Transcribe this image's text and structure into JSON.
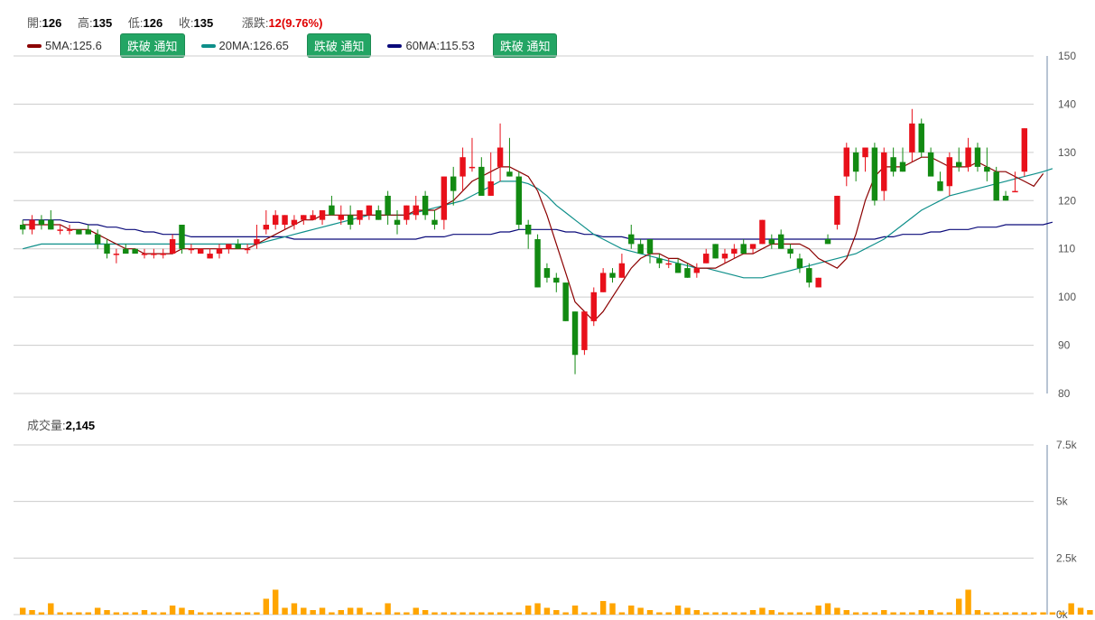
{
  "header": {
    "open_label": "開:",
    "open": "126",
    "high_label": "高:",
    "high": "135",
    "low_label": "低:",
    "low": "126",
    "close_label": "收:",
    "close": "135",
    "change_label": "漲跌:",
    "change": "12(9.76%)"
  },
  "ma_legend": [
    {
      "label": "5MA:125.6",
      "color": "#8b0000",
      "button": "跌破 通知"
    },
    {
      "label": "20MA:126.65",
      "color": "#0e8f8a",
      "button": "跌破 通知"
    },
    {
      "label": "60MA:115.53",
      "color": "#0a0a7a",
      "button": "跌破 通知"
    }
  ],
  "volume_header": {
    "label": "成交量:",
    "value": "2,145"
  },
  "colors": {
    "up": "#e8101a",
    "down": "#128a12",
    "volume": "#ffa500",
    "grid": "#cccccc"
  },
  "chart_data": [
    {
      "type": "candlestick",
      "title": "",
      "ylim": [
        80,
        150
      ],
      "yticks": [
        "150",
        "140",
        "130",
        "120",
        "110",
        "100",
        "90",
        "80"
      ],
      "candles": [
        {
          "o": 115,
          "h": 116,
          "l": 113,
          "c": 114
        },
        {
          "o": 114,
          "h": 117,
          "l": 113,
          "c": 116
        },
        {
          "o": 116,
          "h": 117,
          "l": 114,
          "c": 115
        },
        {
          "o": 116,
          "h": 118,
          "l": 114,
          "c": 114
        },
        {
          "o": 114,
          "h": 115,
          "l": 113,
          "c": 114
        },
        {
          "o": 114,
          "h": 115,
          "l": 113,
          "c": 114
        },
        {
          "o": 114,
          "h": 114,
          "l": 113,
          "c": 113
        },
        {
          "o": 114,
          "h": 115,
          "l": 113,
          "c": 113
        },
        {
          "o": 113,
          "h": 114,
          "l": 110,
          "c": 111
        },
        {
          "o": 111,
          "h": 112,
          "l": 108,
          "c": 109
        },
        {
          "o": 109,
          "h": 110,
          "l": 107,
          "c": 109
        },
        {
          "o": 110,
          "h": 111,
          "l": 109,
          "c": 109
        },
        {
          "o": 110,
          "h": 110,
          "l": 109,
          "c": 109
        },
        {
          "o": 109,
          "h": 110,
          "l": 108,
          "c": 109
        },
        {
          "o": 109,
          "h": 110,
          "l": 108,
          "c": 109
        },
        {
          "o": 109,
          "h": 110,
          "l": 108,
          "c": 109
        },
        {
          "o": 109,
          "h": 113,
          "l": 109,
          "c": 112
        },
        {
          "o": 115,
          "h": 115,
          "l": 109,
          "c": 110
        },
        {
          "o": 110,
          "h": 111,
          "l": 109,
          "c": 110
        },
        {
          "o": 109,
          "h": 110,
          "l": 109,
          "c": 110
        },
        {
          "o": 108,
          "h": 110,
          "l": 108,
          "c": 109
        },
        {
          "o": 109,
          "h": 111,
          "l": 108,
          "c": 110
        },
        {
          "o": 110,
          "h": 111,
          "l": 109,
          "c": 111
        },
        {
          "o": 111,
          "h": 112,
          "l": 110,
          "c": 110
        },
        {
          "o": 110,
          "h": 111,
          "l": 109,
          "c": 110
        },
        {
          "o": 111,
          "h": 115,
          "l": 110,
          "c": 112
        },
        {
          "o": 114,
          "h": 118,
          "l": 113,
          "c": 115
        },
        {
          "o": 115,
          "h": 118,
          "l": 114,
          "c": 117
        },
        {
          "o": 115,
          "h": 117,
          "l": 114,
          "c": 117
        },
        {
          "o": 115,
          "h": 117,
          "l": 114,
          "c": 116
        },
        {
          "o": 116,
          "h": 117,
          "l": 115,
          "c": 117
        },
        {
          "o": 116,
          "h": 118,
          "l": 116,
          "c": 117
        },
        {
          "o": 116,
          "h": 118,
          "l": 115,
          "c": 118
        },
        {
          "o": 119,
          "h": 121,
          "l": 117,
          "c": 117
        },
        {
          "o": 116,
          "h": 119,
          "l": 115,
          "c": 117
        },
        {
          "o": 117,
          "h": 119,
          "l": 114,
          "c": 115
        },
        {
          "o": 116,
          "h": 118,
          "l": 115,
          "c": 118
        },
        {
          "o": 117,
          "h": 119,
          "l": 116,
          "c": 119
        },
        {
          "o": 118,
          "h": 119,
          "l": 116,
          "c": 116
        },
        {
          "o": 121,
          "h": 122,
          "l": 115,
          "c": 117
        },
        {
          "o": 116,
          "h": 118,
          "l": 113,
          "c": 115
        },
        {
          "o": 116,
          "h": 119,
          "l": 115,
          "c": 119
        },
        {
          "o": 117,
          "h": 121,
          "l": 116,
          "c": 119
        },
        {
          "o": 121,
          "h": 122,
          "l": 116,
          "c": 117
        },
        {
          "o": 116,
          "h": 118,
          "l": 114,
          "c": 115
        },
        {
          "o": 116,
          "h": 125,
          "l": 114,
          "c": 125
        },
        {
          "o": 125,
          "h": 127,
          "l": 119,
          "c": 122
        },
        {
          "o": 125,
          "h": 131,
          "l": 122,
          "c": 129
        },
        {
          "o": 127,
          "h": 133,
          "l": 126,
          "c": 127
        },
        {
          "o": 127,
          "h": 129,
          "l": 124,
          "c": 121
        },
        {
          "o": 121,
          "h": 130,
          "l": 121,
          "c": 124
        },
        {
          "o": 127,
          "h": 136,
          "l": 124,
          "c": 131
        },
        {
          "o": 126,
          "h": 133,
          "l": 125,
          "c": 125
        },
        {
          "o": 125,
          "h": 126,
          "l": 114,
          "c": 115
        },
        {
          "o": 115,
          "h": 116,
          "l": 110,
          "c": 113
        },
        {
          "o": 112,
          "h": 113,
          "l": 102,
          "c": 102
        },
        {
          "o": 106,
          "h": 107,
          "l": 103,
          "c": 104
        },
        {
          "o": 104,
          "h": 105,
          "l": 101,
          "c": 103
        },
        {
          "o": 103,
          "h": 103,
          "l": 95,
          "c": 95
        },
        {
          "o": 97,
          "h": 97,
          "l": 84,
          "c": 88
        },
        {
          "o": 89,
          "h": 97,
          "l": 88,
          "c": 97
        },
        {
          "o": 95,
          "h": 102,
          "l": 94,
          "c": 101
        },
        {
          "o": 101,
          "h": 106,
          "l": 101,
          "c": 105
        },
        {
          "o": 105,
          "h": 106,
          "l": 103,
          "c": 104
        },
        {
          "o": 104,
          "h": 109,
          "l": 104,
          "c": 107
        },
        {
          "o": 113,
          "h": 115,
          "l": 110,
          "c": 111
        },
        {
          "o": 111,
          "h": 112,
          "l": 109,
          "c": 109
        },
        {
          "o": 112,
          "h": 112,
          "l": 107,
          "c": 109
        },
        {
          "o": 108,
          "h": 109,
          "l": 106,
          "c": 107
        },
        {
          "o": 107,
          "h": 108,
          "l": 106,
          "c": 107
        },
        {
          "o": 107,
          "h": 108,
          "l": 105,
          "c": 105
        },
        {
          "o": 106,
          "h": 107,
          "l": 104,
          "c": 104
        },
        {
          "o": 105,
          "h": 107,
          "l": 104,
          "c": 106
        },
        {
          "o": 107,
          "h": 110,
          "l": 107,
          "c": 109
        },
        {
          "o": 111,
          "h": 111,
          "l": 108,
          "c": 108
        },
        {
          "o": 108,
          "h": 110,
          "l": 107,
          "c": 109
        },
        {
          "o": 109,
          "h": 111,
          "l": 108,
          "c": 110
        },
        {
          "o": 111,
          "h": 112,
          "l": 109,
          "c": 109
        },
        {
          "o": 110,
          "h": 111,
          "l": 109,
          "c": 111
        },
        {
          "o": 111,
          "h": 116,
          "l": 111,
          "c": 116
        },
        {
          "o": 112,
          "h": 113,
          "l": 110,
          "c": 111
        },
        {
          "o": 113,
          "h": 114,
          "l": 110,
          "c": 110
        },
        {
          "o": 110,
          "h": 111,
          "l": 108,
          "c": 109
        },
        {
          "o": 108,
          "h": 109,
          "l": 105,
          "c": 106
        },
        {
          "o": 106,
          "h": 107,
          "l": 102,
          "c": 103
        },
        {
          "o": 102,
          "h": 104,
          "l": 102,
          "c": 104
        },
        {
          "o": 112,
          "h": 113,
          "l": 111,
          "c": 111
        },
        {
          "o": 115,
          "h": 121,
          "l": 114,
          "c": 121
        },
        {
          "o": 125,
          "h": 132,
          "l": 123,
          "c": 131
        },
        {
          "o": 130,
          "h": 131,
          "l": 124,
          "c": 126
        },
        {
          "o": 129,
          "h": 131,
          "l": 126,
          "c": 131
        },
        {
          "o": 131,
          "h": 132,
          "l": 119,
          "c": 120
        },
        {
          "o": 122,
          "h": 131,
          "l": 120,
          "c": 130
        },
        {
          "o": 129,
          "h": 131,
          "l": 125,
          "c": 126
        },
        {
          "o": 128,
          "h": 131,
          "l": 126,
          "c": 126
        },
        {
          "o": 130,
          "h": 139,
          "l": 128,
          "c": 136
        },
        {
          "o": 136,
          "h": 137,
          "l": 129,
          "c": 130
        },
        {
          "o": 130,
          "h": 131,
          "l": 126,
          "c": 125
        },
        {
          "o": 124,
          "h": 126,
          "l": 122,
          "c": 122
        },
        {
          "o": 123,
          "h": 130,
          "l": 121,
          "c": 129
        },
        {
          "o": 128,
          "h": 131,
          "l": 126,
          "c": 127
        },
        {
          "o": 127,
          "h": 133,
          "l": 126,
          "c": 131
        },
        {
          "o": 131,
          "h": 132,
          "l": 126,
          "c": 127
        },
        {
          "o": 127,
          "h": 131,
          "l": 124,
          "c": 126
        },
        {
          "o": 126,
          "h": 127,
          "l": 120,
          "c": 120
        },
        {
          "o": 121,
          "h": 122,
          "l": 120,
          "c": 120
        },
        {
          "o": 122,
          "h": 126,
          "l": 122,
          "c": 122
        },
        {
          "o": 126,
          "h": 135,
          "l": 125,
          "c": 135
        }
      ],
      "ma5": [
        115,
        115,
        115,
        115,
        115,
        114,
        114,
        114,
        113,
        112,
        111,
        110,
        110,
        109,
        109,
        109,
        109,
        110,
        110,
        110,
        110,
        110,
        110,
        110,
        110,
        111,
        112,
        113,
        114,
        115,
        116,
        116,
        117,
        117,
        117,
        117,
        117,
        117,
        117,
        117,
        117,
        117,
        118,
        118,
        118,
        119,
        120,
        122,
        124,
        125,
        126,
        127,
        127,
        126,
        125,
        122,
        117,
        111,
        105,
        99,
        97,
        95,
        97,
        100,
        103,
        106,
        108,
        109,
        109,
        108,
        108,
        107,
        106,
        106,
        106,
        107,
        108,
        109,
        109,
        110,
        111,
        111,
        111,
        111,
        110,
        108,
        107,
        106,
        108,
        113,
        120,
        125,
        127,
        127,
        127,
        128,
        129,
        129,
        128,
        127,
        127,
        127,
        128,
        127,
        126,
        126,
        125,
        124,
        123,
        125.6
      ],
      "ma20": [
        110,
        110.5,
        111,
        111,
        111,
        111,
        111,
        111,
        111,
        111,
        111,
        111,
        111,
        111,
        111,
        111,
        111,
        111,
        111,
        111,
        111,
        111,
        111,
        111,
        111,
        111,
        111.5,
        112,
        112.5,
        113,
        113.5,
        114,
        114.5,
        115,
        115.5,
        116,
        116.5,
        117,
        117,
        117,
        117,
        117,
        117.5,
        118,
        118.5,
        119,
        119.5,
        120,
        121,
        122,
        123,
        124,
        124,
        124,
        123.5,
        122.5,
        121,
        119,
        117.5,
        116,
        114.5,
        113,
        112,
        111,
        110,
        109.5,
        109,
        108.5,
        108,
        107.5,
        107,
        106.5,
        106,
        106,
        105.5,
        105,
        104.5,
        104,
        104,
        104,
        104.5,
        105,
        105.5,
        106,
        106.5,
        107,
        107.5,
        108,
        108.5,
        109,
        110,
        111,
        112,
        113.5,
        115,
        116.5,
        118,
        119,
        120,
        121,
        121.5,
        122,
        122.5,
        123,
        123.5,
        124,
        124.5,
        125,
        125.5,
        126,
        126.65
      ],
      "ma60": [
        116,
        116,
        116,
        116,
        116,
        115.5,
        115.5,
        115,
        115,
        114.5,
        114.5,
        114,
        114,
        113.5,
        113.5,
        113,
        113,
        113,
        112.5,
        112.5,
        112.5,
        112.5,
        112.5,
        112.5,
        112.5,
        112.5,
        112.5,
        112.5,
        112.5,
        112,
        112,
        112,
        112,
        112,
        112,
        112,
        112,
        112,
        112,
        112,
        112,
        112,
        112,
        112.5,
        112.5,
        112.5,
        113,
        113,
        113,
        113,
        113,
        113.5,
        113.5,
        114,
        114,
        114,
        114,
        114,
        113.5,
        113.5,
        113,
        113,
        112.5,
        112.5,
        112.5,
        112,
        112,
        112,
        112,
        112,
        112,
        112,
        112,
        112,
        112,
        112,
        112,
        112,
        112,
        112,
        112,
        112,
        112,
        112,
        112,
        112,
        112,
        112,
        112,
        112,
        112,
        112,
        112.5,
        112.5,
        113,
        113,
        113,
        113.5,
        113.5,
        114,
        114,
        114,
        114.5,
        114.5,
        114.5,
        115,
        115,
        115,
        115,
        115,
        115.53
      ]
    },
    {
      "type": "bar",
      "title": "",
      "ylim": [
        0,
        7500
      ],
      "yticks": [
        "7.5k",
        "5k",
        "2.5k",
        "0k"
      ],
      "values": [
        300,
        200,
        100,
        500,
        100,
        100,
        100,
        100,
        300,
        200,
        100,
        100,
        100,
        200,
        100,
        100,
        400,
        300,
        200,
        100,
        100,
        100,
        100,
        100,
        100,
        100,
        700,
        1100,
        300,
        500,
        300,
        200,
        300,
        100,
        200,
        300,
        300,
        100,
        100,
        500,
        100,
        100,
        300,
        200,
        100,
        100,
        100,
        100,
        100,
        100,
        100,
        100,
        100,
        100,
        400,
        500,
        300,
        200,
        100,
        400,
        100,
        100,
        600,
        500,
        100,
        400,
        300,
        200,
        100,
        100,
        400,
        300,
        200,
        100,
        100,
        100,
        100,
        100,
        200,
        300,
        200,
        100,
        100,
        100,
        100,
        400,
        500,
        300,
        200,
        100,
        100,
        100,
        200,
        100,
        100,
        100,
        200,
        200,
        100,
        100,
        700,
        1100,
        200,
        100,
        100,
        100,
        100,
        100,
        100,
        100,
        100,
        100,
        500,
        300,
        200,
        100,
        100,
        600,
        100,
        200
      ]
    }
  ]
}
